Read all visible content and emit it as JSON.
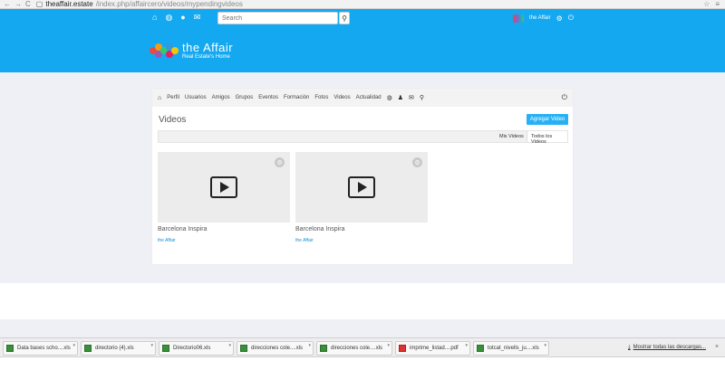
{
  "browser": {
    "url_domain": "theaffair.estate",
    "url_path": "/index.php/affaircero/videos/mypendingvideos"
  },
  "topnav": {
    "search_placeholder": "Search",
    "user_name": "the Affair"
  },
  "logo": {
    "title": "the Affair",
    "subtitle": "Real Estate's Home"
  },
  "subnav": {
    "items": [
      "Perfil",
      "Usuarios",
      "Amigos",
      "Grupos",
      "Eventos",
      "Formación",
      "Fotos",
      "Videos",
      "Actualidad"
    ]
  },
  "videos": {
    "title": "Videos",
    "add_button": "Agregar Video",
    "tab_mine": "Mis Videos",
    "tab_all": "Todos los Videos",
    "items": [
      {
        "title": "Barcelona Inspira",
        "user": "the Affair"
      },
      {
        "title": "Barcelona Inspira",
        "user": "the Affair"
      }
    ]
  },
  "downloads": {
    "items": [
      {
        "name": "Data bases scho....xls",
        "type": "xls"
      },
      {
        "name": "directorio (4).xls",
        "type": "xls"
      },
      {
        "name": "Directorio06.xls",
        "type": "xls"
      },
      {
        "name": "direcciones cole....xls",
        "type": "xls"
      },
      {
        "name": "direcciones cole....xls",
        "type": "xls"
      },
      {
        "name": "imprime_listad....pdf",
        "type": "pdf"
      },
      {
        "name": "totcat_nivells_ju....xls",
        "type": "xls"
      }
    ],
    "show_all": "Mostrar todas las descargas...",
    "close": "×"
  }
}
